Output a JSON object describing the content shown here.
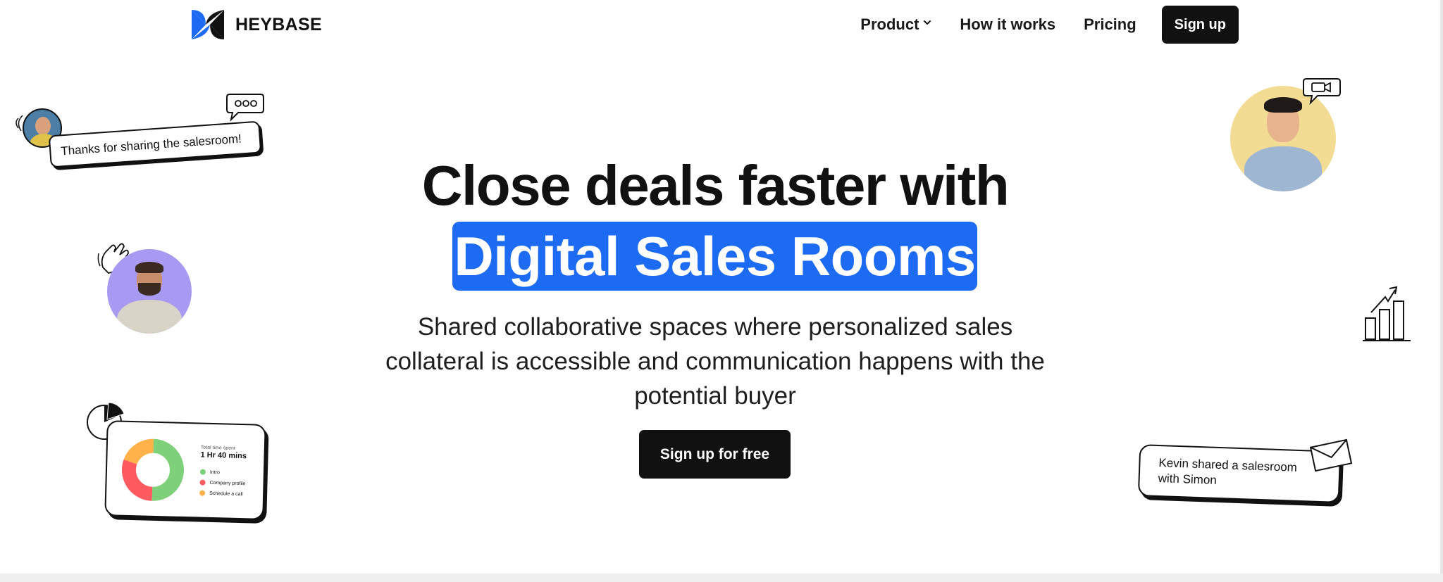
{
  "brand": {
    "name": "HEYBASE",
    "logo_icon": "heybase-logo-icon",
    "accent": "#1d6bf2"
  },
  "nav": {
    "items": [
      {
        "label": "Product",
        "has_dropdown": true
      },
      {
        "label": "How it works"
      },
      {
        "label": "Pricing"
      }
    ],
    "signup_label": "Sign up"
  },
  "hero": {
    "title_line1": "Close deals faster with",
    "title_highlight": "Digital Sales Rooms",
    "subtitle": "Shared collaborative spaces where personalized sales collateral is accessible and communication happens with the potential buyer",
    "cta_label": "Sign up for free"
  },
  "decor": {
    "chat_bubble_text": "Thanks for sharing the salesroom!",
    "share_card_text_line1": "Kevin shared a salesroom",
    "share_card_text_line2": "with Simon",
    "time_card": {
      "label": "Total time spent",
      "value": "1 Hr 40 mins",
      "legend": [
        {
          "label": "Intro",
          "color": "#7ed17a"
        },
        {
          "label": "Company profile",
          "color": "#ff5a5f"
        },
        {
          "label": "Schedule a call",
          "color": "#ffb14a"
        }
      ],
      "donut_fractions": [
        0.5,
        0.3,
        0.2
      ]
    }
  }
}
